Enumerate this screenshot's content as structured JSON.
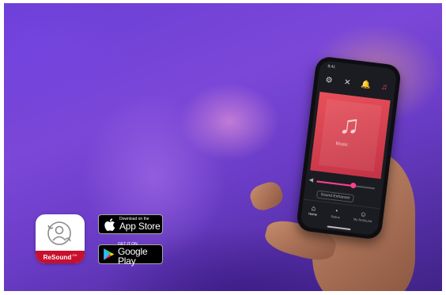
{
  "phone_app": {
    "status_time": "9:41",
    "tabs": [
      {
        "icon": "gear-icon"
      },
      {
        "icon": "tools-icon"
      },
      {
        "icon": "bell-icon"
      },
      {
        "icon": "music-note-icon",
        "active": true
      }
    ],
    "program_label": "Music",
    "sound_enhancer_label": "Sound Enhancer",
    "nav": [
      {
        "label": "Home",
        "icon": "home-icon",
        "active": true
      },
      {
        "label": "Status",
        "icon": "status-icon"
      },
      {
        "label": "My ReSound",
        "icon": "person-icon"
      }
    ],
    "volume_level": 0.62
  },
  "app_icon": {
    "brand_name": "ReSound",
    "brand_suffix": "GN",
    "band_color": "#c8102e"
  },
  "app_store_badge": {
    "small_text": "Download on the",
    "large_text": "App Store"
  },
  "google_play_badge": {
    "small_text": "GET IT ON",
    "large_text": "Google Play"
  }
}
